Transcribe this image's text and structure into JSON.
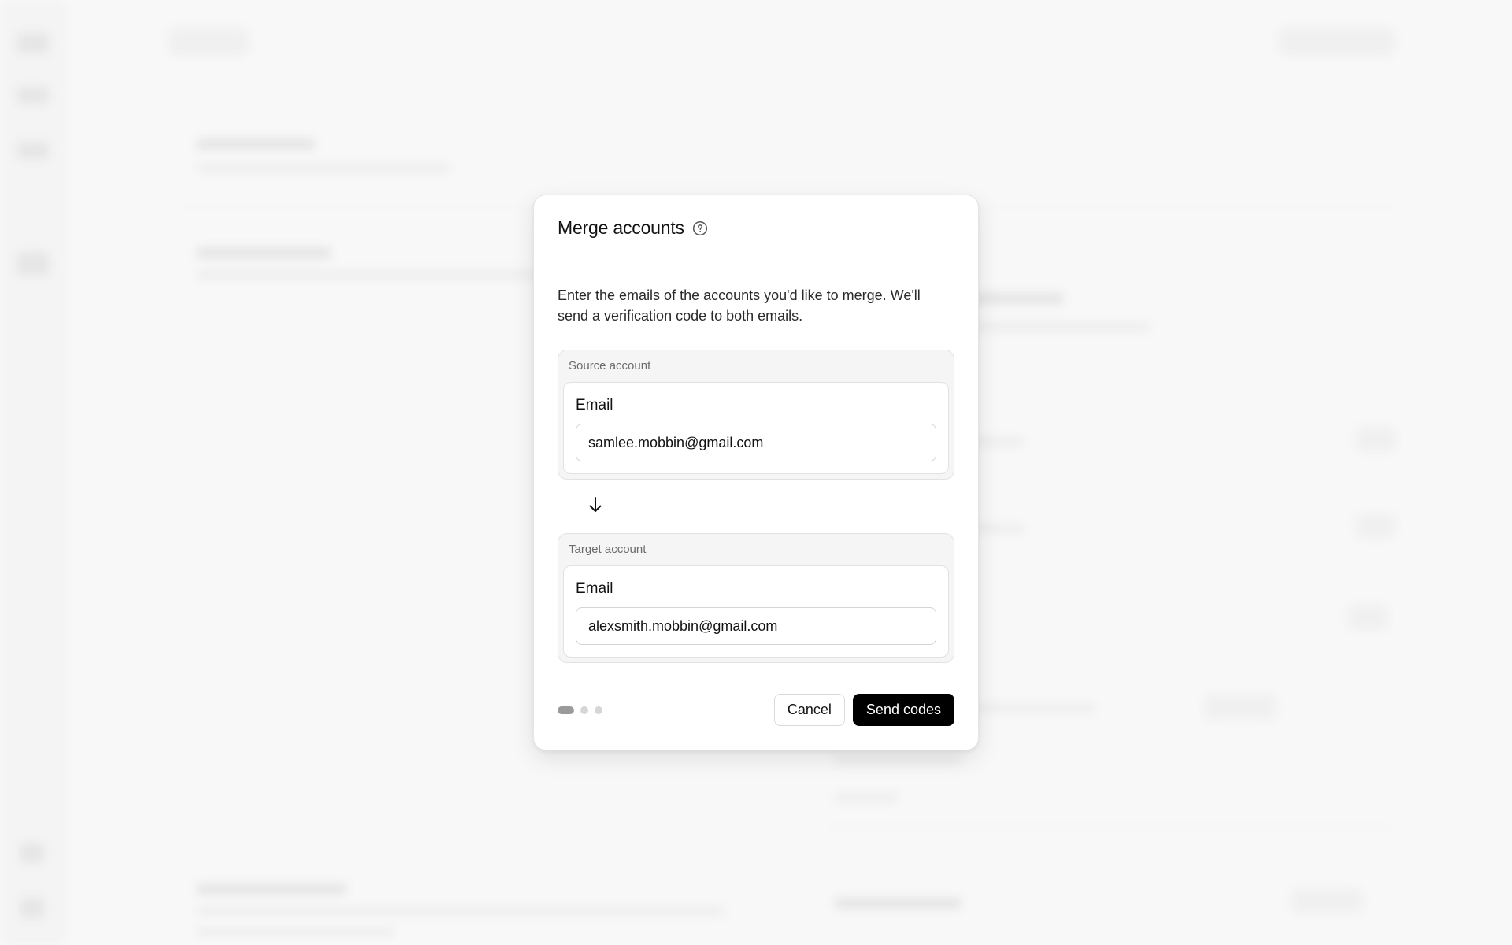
{
  "modal": {
    "title": "Merge accounts",
    "help_icon": "question-circle-icon",
    "description": "Enter the emails of the accounts you'd like to merge. We'll send a verification code to both emails.",
    "source": {
      "group_label": "Source account",
      "field_label": "Email",
      "value": "samlee.mobbin@gmail.com"
    },
    "arrow_icon": "arrow-down-icon",
    "target": {
      "group_label": "Target account",
      "field_label": "Email",
      "value": "alexsmith.mobbin@gmail.com"
    },
    "steps": {
      "total": 3,
      "current": 1
    },
    "cancel_label": "Cancel",
    "submit_label": "Send codes"
  },
  "colors": {
    "primary_button": "#000000",
    "page_background": "#fafafa"
  }
}
